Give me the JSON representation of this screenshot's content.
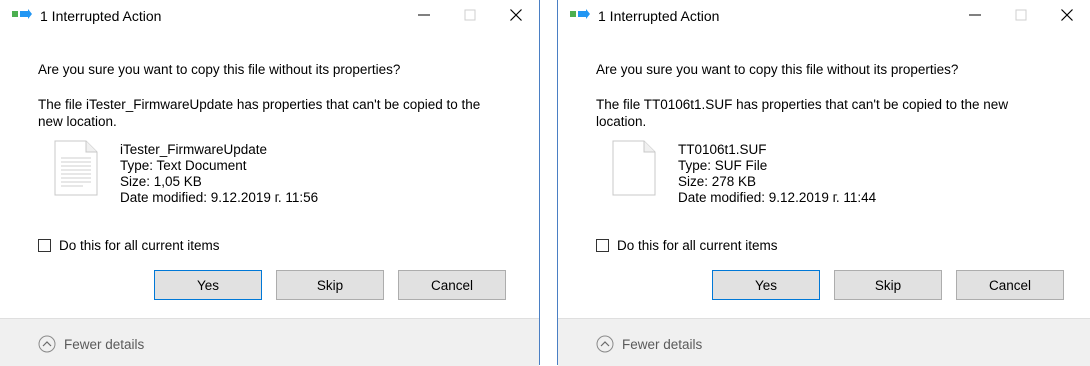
{
  "dialogs": [
    {
      "title": "1 Interrupted Action",
      "question": "Are you sure you want to copy this file without its properties?",
      "info_line1": "The file iTester_FirmwareUpdate has properties that can't be copied to the",
      "info_line2": "new location.",
      "file": {
        "name": "iTester_FirmwareUpdate",
        "type": "Type: Text Document",
        "size": "Size: 1,05 KB",
        "date_modified": "Date modified: 9.12.2019 г. 11:56",
        "icon": "text-document-icon"
      },
      "checkbox_label": "Do this for all current items",
      "checkbox_checked": false,
      "buttons": {
        "yes": "Yes",
        "skip": "Skip",
        "cancel": "Cancel"
      },
      "footer": "Fewer details"
    },
    {
      "title": "1 Interrupted Action",
      "question": "Are you sure you want to copy this file without its properties?",
      "info_line1": "The file TT0106t1.SUF has properties that can't be copied to the new",
      "info_line2": "location.",
      "file": {
        "name": "TT0106t1.SUF",
        "type": "Type: SUF File",
        "size": "Size: 278 KB",
        "date_modified": "Date modified: 9.12.2019 г. 11:44",
        "icon": "blank-file-icon"
      },
      "checkbox_label": "Do this for all current items",
      "checkbox_checked": false,
      "buttons": {
        "yes": "Yes",
        "skip": "Skip",
        "cancel": "Cancel"
      },
      "footer": "Fewer details"
    }
  ],
  "colors": {
    "accent": "#0078d7",
    "button_bg": "#e1e1e1",
    "footer_bg": "#f0f0f0",
    "window_border": "#4a7fc4"
  }
}
